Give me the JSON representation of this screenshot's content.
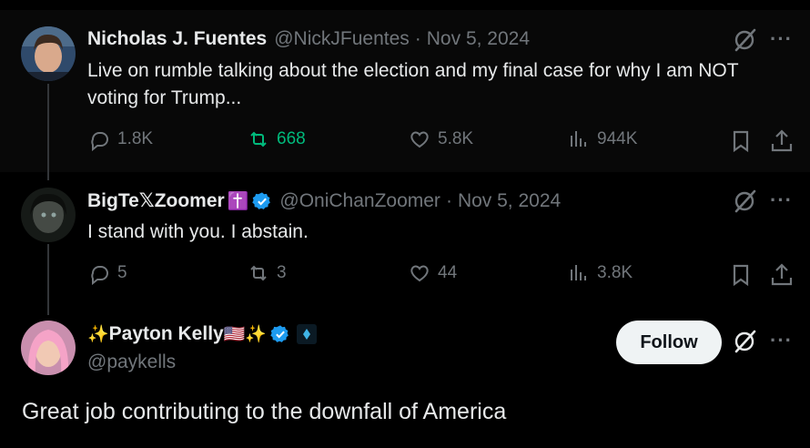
{
  "tweets": [
    {
      "name": "Nicholas J. Fuentes",
      "handle": "@NickJFuentes",
      "separator": "·",
      "date": "Nov 5, 2024",
      "text": "Live on rumble talking about the election and my final case for why I am NOT voting for Trump...",
      "replies": "1.8K",
      "retweets": "668",
      "likes": "5.8K",
      "views": "944K",
      "retweeted": true,
      "more": "···"
    },
    {
      "name": "BigTe𝕏Zoomer",
      "name_emoji": "✝️",
      "verified": true,
      "handle": "@OniChanZoomer",
      "separator": "·",
      "date": "Nov 5, 2024",
      "text": "I stand with you. I abstain.",
      "replies": "5",
      "retweets": "3",
      "likes": "44",
      "views": "3.8K",
      "more": "···"
    }
  ],
  "main_tweet": {
    "name_prefix": "✨",
    "name": "Payton Kelly",
    "name_suffix": "🇺🇸✨",
    "verified": true,
    "handle": "@paykells",
    "follow_label": "Follow",
    "text": "Great job contributing to the downfall of America",
    "more": "···"
  },
  "colors": {
    "background": "#000000",
    "text": "#e7e9ea",
    "muted": "#71767b",
    "retweet_green": "#00ba7c",
    "verified_blue": "#1d9bf0",
    "follow_bg": "#eff3f4"
  }
}
